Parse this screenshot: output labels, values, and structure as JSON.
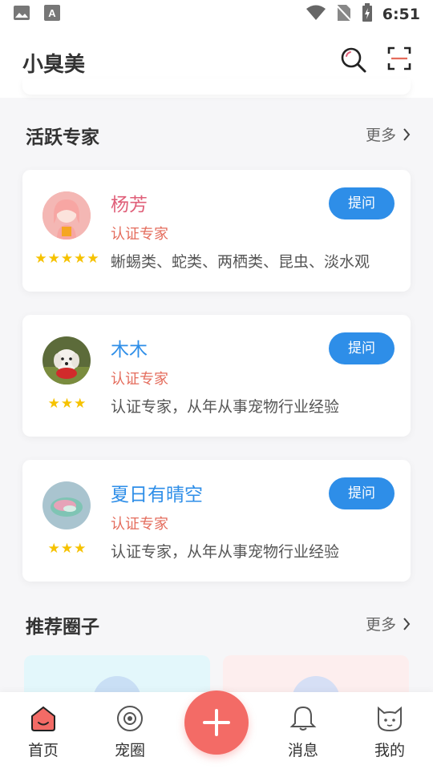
{
  "status_bar": {
    "time": "6:51"
  },
  "app": {
    "title": "小臭美"
  },
  "sections": {
    "experts": {
      "title": "活跃专家",
      "more": "更多"
    },
    "circles": {
      "title": "推荐圈子",
      "more": "更多"
    }
  },
  "experts": [
    {
      "name": "杨芳",
      "name_color": "#e0607a",
      "role": "认证专家",
      "description": "蜥蜴类、蛇类、两栖类、昆虫、淡水观",
      "stars": "★★★★★",
      "star_rating": 5,
      "ask_label": "提问"
    },
    {
      "name": "木木",
      "name_color": "#2e8ee8",
      "role": "认证专家",
      "description": "认证专家，从年从事宠物行业经验",
      "stars": "★★★",
      "star_rating": 3,
      "ask_label": "提问"
    },
    {
      "name": "夏日有晴空",
      "name_color": "#2e8ee8",
      "role": "认证专家",
      "description": "认证专家，从年从事宠物行业经验",
      "stars": "★★★",
      "star_rating": 3,
      "ask_label": "提问"
    }
  ],
  "tabs": [
    {
      "label": "首页",
      "icon": "home-icon"
    },
    {
      "label": "宠圈",
      "icon": "pet-circle-icon"
    },
    {
      "label": "",
      "icon": "plus-icon"
    },
    {
      "label": "消息",
      "icon": "bell-icon"
    },
    {
      "label": "我的",
      "icon": "cat-face-icon"
    }
  ],
  "colors": {
    "accent_blue": "#2e8ee8",
    "fab_red": "#f36b66",
    "role_red": "#e46c5c",
    "star_yellow": "#f6c200"
  }
}
